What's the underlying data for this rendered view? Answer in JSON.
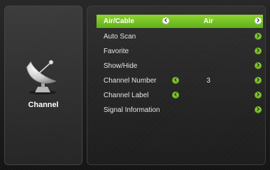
{
  "sidebar": {
    "title": "Channel",
    "icon": "satellite-dish-icon"
  },
  "menu": {
    "items": [
      {
        "label": "Air/Cable",
        "value": "Air",
        "left_arrow": true,
        "right_arrow": true,
        "selected": true
      },
      {
        "label": "Auto Scan",
        "value": "",
        "left_arrow": false,
        "right_arrow": true,
        "selected": false
      },
      {
        "label": "Favorite",
        "value": "",
        "left_arrow": false,
        "right_arrow": true,
        "selected": false
      },
      {
        "label": "Show/Hide",
        "value": "",
        "left_arrow": false,
        "right_arrow": true,
        "selected": false
      },
      {
        "label": "Channel Number",
        "value": "3",
        "left_arrow": true,
        "right_arrow": true,
        "selected": false
      },
      {
        "label": "Channel Label",
        "value": "",
        "left_arrow": true,
        "right_arrow": true,
        "selected": false
      },
      {
        "label": "Signal Information",
        "value": "",
        "left_arrow": false,
        "right_arrow": true,
        "selected": false
      }
    ]
  },
  "colors": {
    "accent": "#7ec42d",
    "selected_row": "#6fbe22"
  }
}
